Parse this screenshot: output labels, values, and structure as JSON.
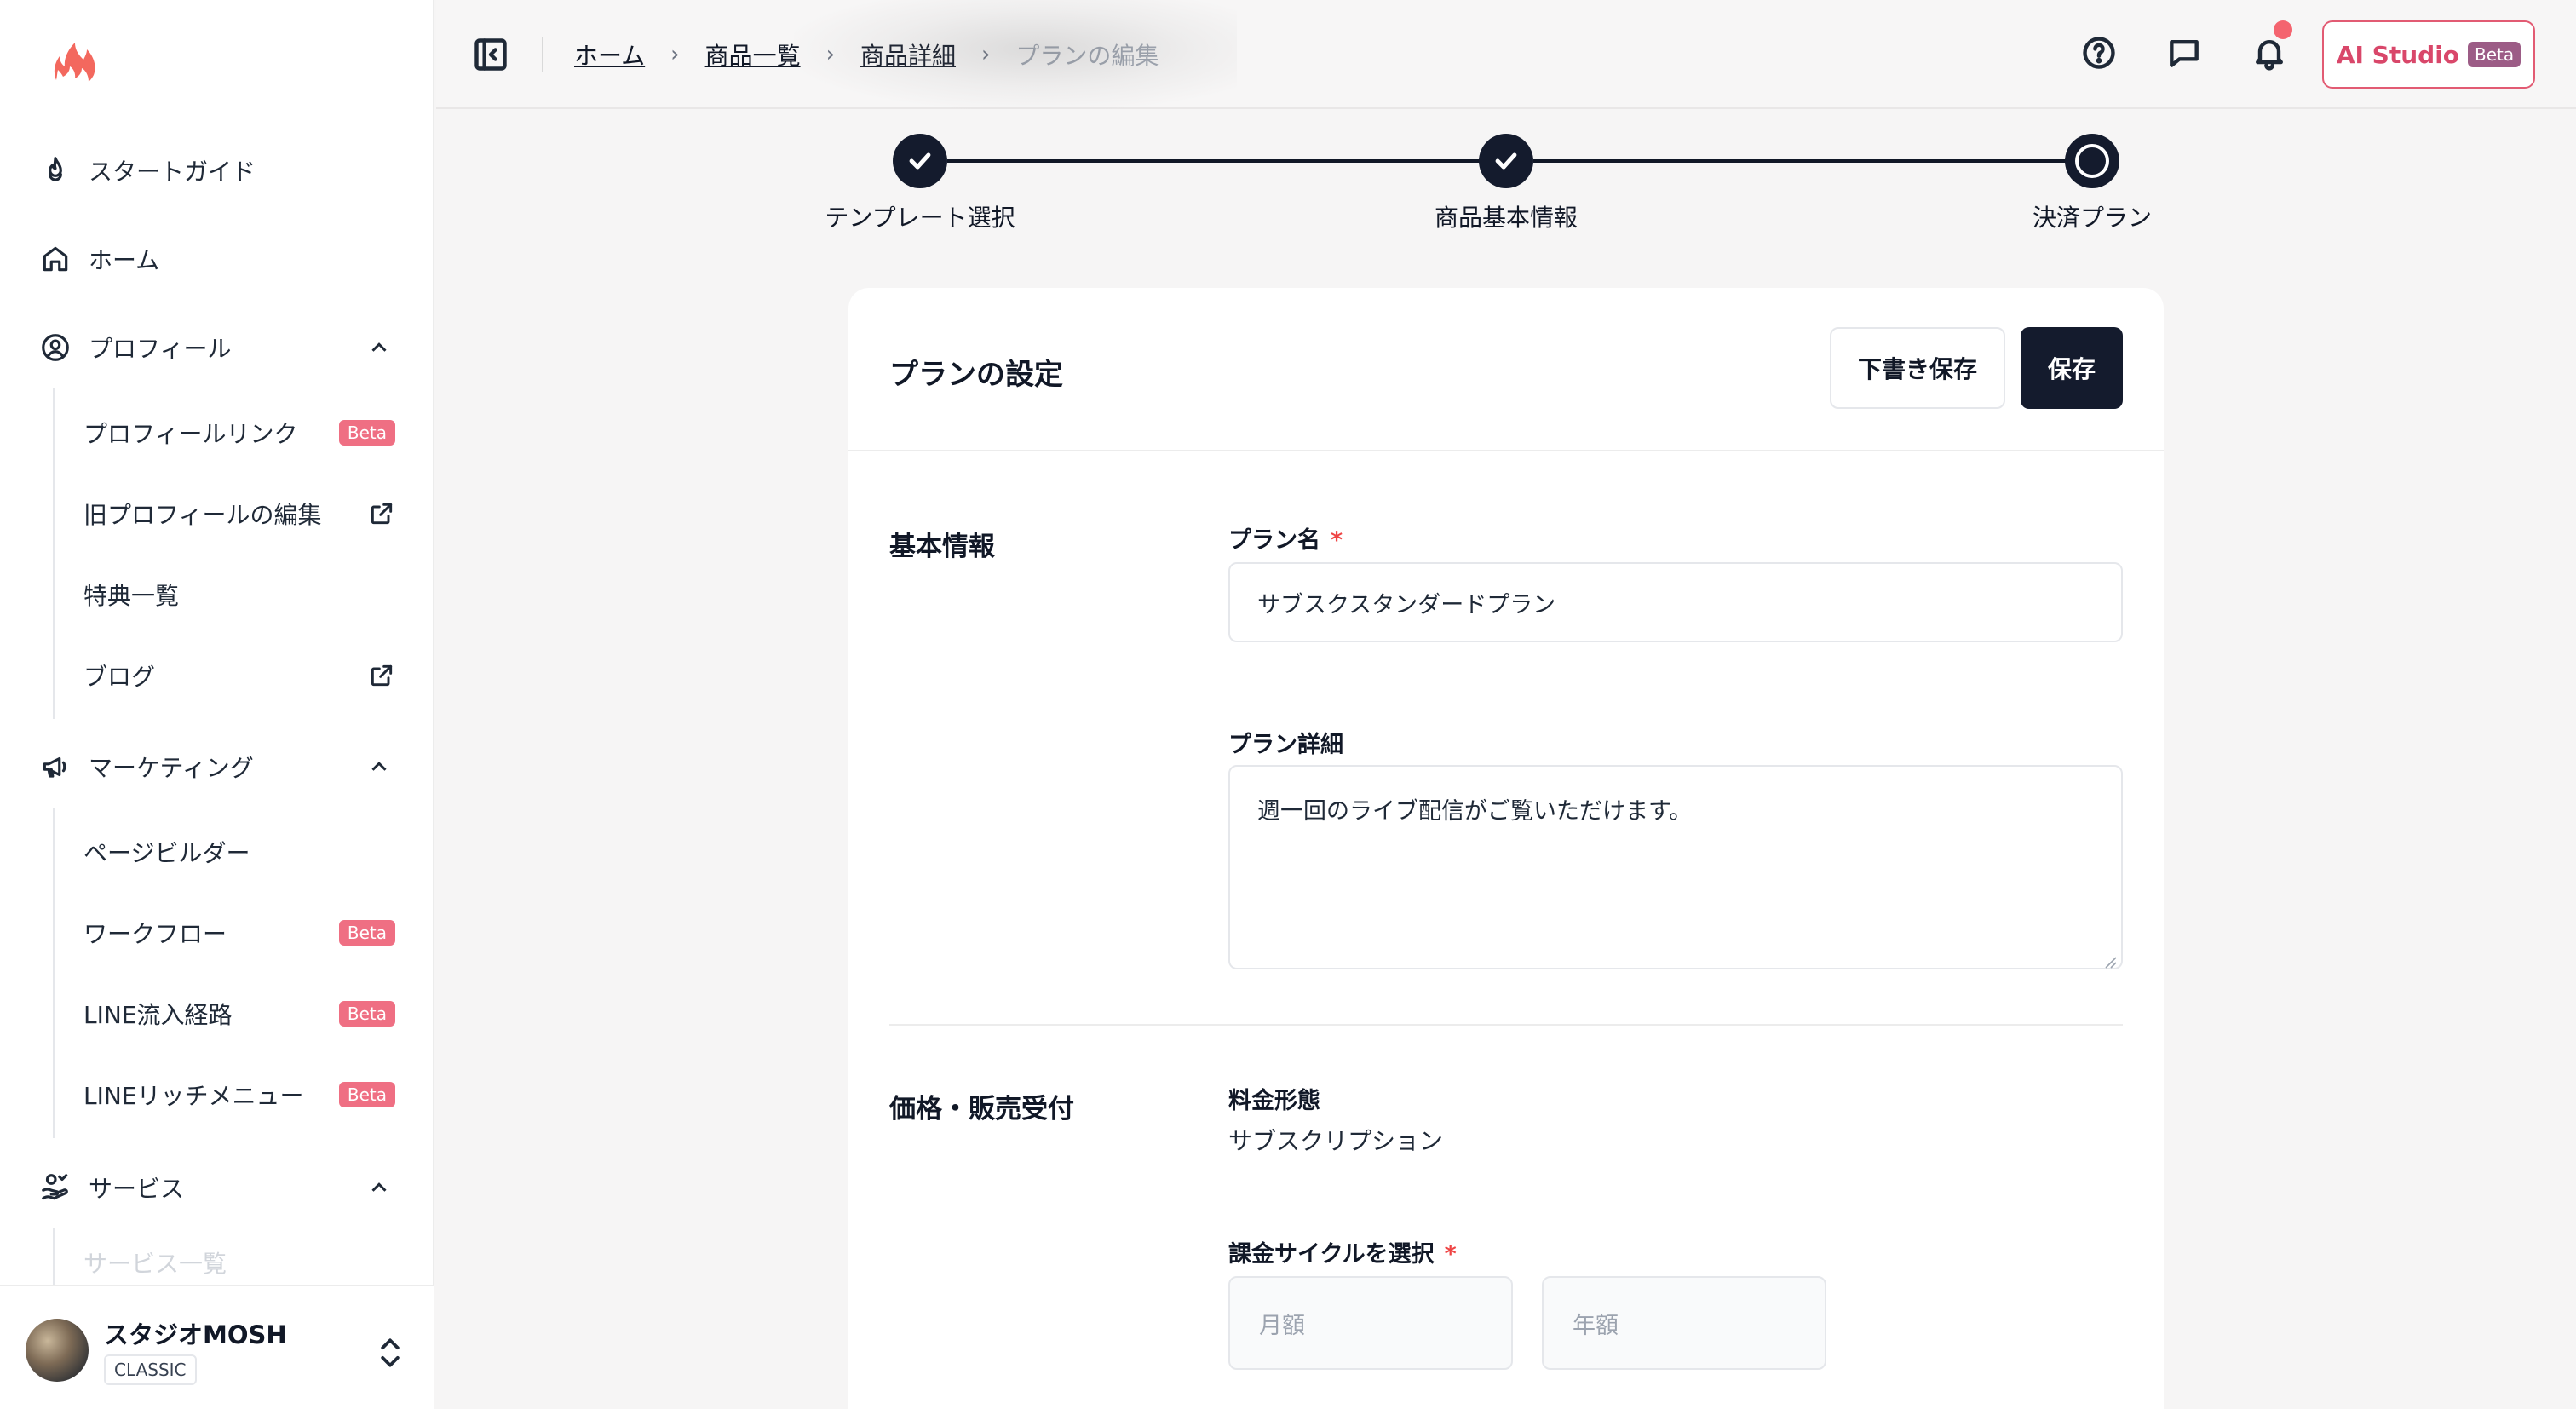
{
  "sidebar": {
    "items": {
      "start_guide": "スタートガイド",
      "home": "ホーム",
      "profile": "プロフィール",
      "marketing": "マーケティング",
      "service": "サービス"
    },
    "profile_sub": [
      {
        "label": "プロフィールリンク",
        "badge": "Beta"
      },
      {
        "label": "旧プロフィールの編集"
      },
      {
        "label": "特典一覧"
      },
      {
        "label": "ブログ"
      }
    ],
    "marketing_sub": [
      {
        "label": "ページビルダー"
      },
      {
        "label": "ワークフロー",
        "badge": "Beta"
      },
      {
        "label": "LINE流入経路",
        "badge": "Beta"
      },
      {
        "label": "LINEリッチメニュー",
        "badge": "Beta"
      }
    ],
    "service_sub": [
      {
        "label": "サービス一覧"
      }
    ],
    "account": {
      "name": "スタジオMOSH",
      "plan": "CLASSIC"
    }
  },
  "header": {
    "breadcrumb": [
      "ホーム",
      "商品一覧",
      "商品詳細"
    ],
    "breadcrumb_current": "プランの編集",
    "ai_button": "AI Studio",
    "ai_badge": "Beta"
  },
  "stepper": {
    "steps": [
      "テンプレート選択",
      "商品基本情報",
      "決済プラン"
    ]
  },
  "card": {
    "title": "プランの設定",
    "draft_button": "下書き保存",
    "save_button": "保存",
    "basic": {
      "section_title": "基本情報",
      "plan_name_label": "プラン名",
      "required_mark": "*",
      "plan_name_value": "サブスクスタンダードプラン",
      "plan_detail_label": "プラン詳細",
      "plan_detail_value": "週一回のライブ配信がご覧いただけます。"
    },
    "price": {
      "section_title": "価格・販売受付",
      "fee_type_label": "料金形態",
      "fee_type_value": "サブスクリプション",
      "cycle_label": "課金サイクルを選択",
      "cycle_options": [
        "月額",
        "年額"
      ]
    }
  },
  "colors": {
    "accent_dark": "#141b2d",
    "brand_pink": "#e25b73",
    "beta_badge": "#ef6f83",
    "notification": "#f4646f"
  }
}
